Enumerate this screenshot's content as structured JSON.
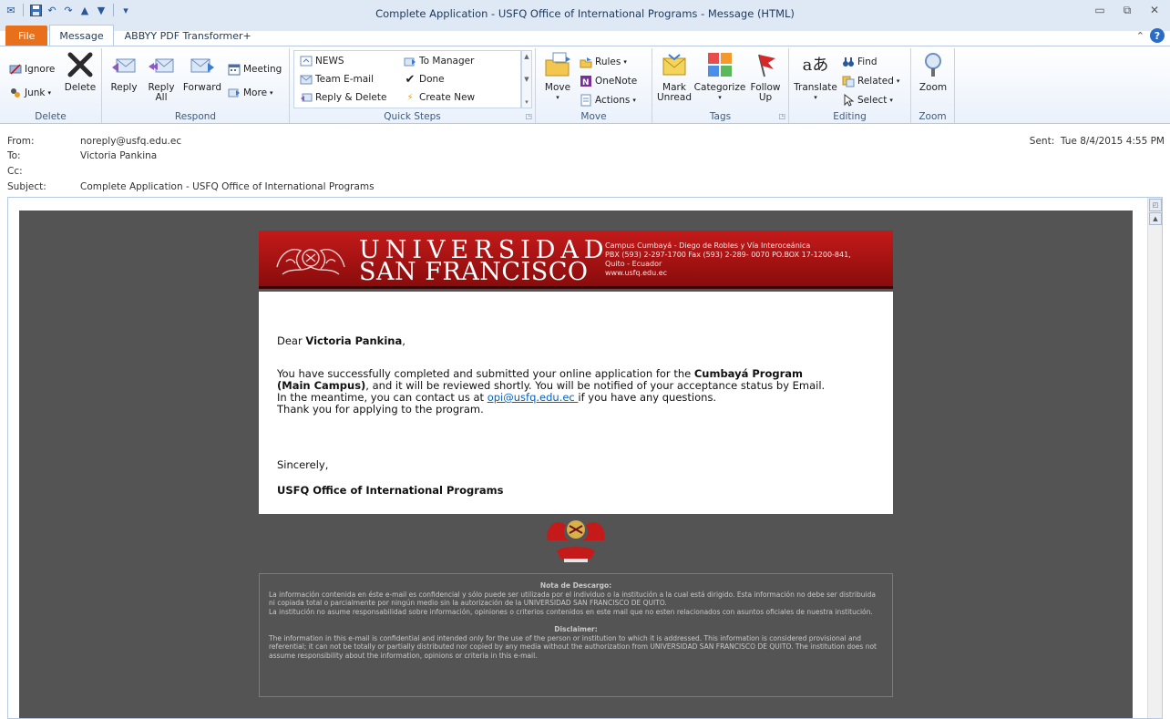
{
  "window": {
    "title": "Complete Application - USFQ Office of International Programs  -  Message (HTML)"
  },
  "tabs": [
    {
      "label": "File"
    },
    {
      "label": "Message"
    },
    {
      "label": "ABBYY PDF Transformer+"
    }
  ],
  "ribbon": {
    "delete_group": {
      "label": "Delete",
      "ignore": "Ignore",
      "junk": "Junk",
      "delete": "Delete"
    },
    "respond_group": {
      "label": "Respond",
      "reply": "Reply",
      "reply_all_1": "Reply",
      "reply_all_2": "All",
      "forward": "Forward",
      "meeting": "Meeting",
      "more": "More"
    },
    "quicksteps_group": {
      "label": "Quick Steps",
      "items": [
        "NEWS",
        "Team E-mail",
        "Reply & Delete",
        "To Manager",
        "Done",
        "Create New"
      ]
    },
    "move_group": {
      "label": "Move",
      "move": "Move",
      "rules": "Rules",
      "onenote": "OneNote",
      "actions": "Actions"
    },
    "tags_group": {
      "label": "Tags",
      "mark_unread_1": "Mark",
      "mark_unread_2": "Unread",
      "categorize": "Categorize",
      "follow_up_1": "Follow",
      "follow_up_2": "Up"
    },
    "editing_group": {
      "label": "Editing",
      "translate": "Translate",
      "find": "Find",
      "related": "Related",
      "select": "Select"
    },
    "zoom_group": {
      "label": "Zoom",
      "zoom": "Zoom"
    }
  },
  "header": {
    "from_label": "From:",
    "from_value": "noreply@usfq.edu.ec",
    "to_label": "To:",
    "to_value": "Victoria Pankina",
    "cc_label": "Cc:",
    "subject_label": "Subject:",
    "subject_value": "Complete Application - USFQ Office of International Programs",
    "sent_label": "Sent:",
    "sent_value": "Tue 8/4/2015 4:55 PM"
  },
  "banner": {
    "line1": "UNIVERSIDAD",
    "line2": "SAN FRANCISCO",
    "info1": "Campus Cumbayá - Diego de Robles y Vía Interoceánica",
    "info2": "PBX (593) 2-297-1700     Fax (593) 2-289- 0070     PO.BOX 17-1200-841,",
    "info3": "Quito - Ecuador",
    "info4": "www.usfq.edu.ec"
  },
  "message": {
    "greeting_prefix": "Dear ",
    "recipient": "Victoria Pankina",
    "greeting_suffix": ",",
    "body_1": "You have successfully completed and submitted your online application for the ",
    "program_1": "Cumbayá Program",
    "program_2": "(Main Campus)",
    "body_2": ", and it will be reviewed shortly. You will be notified of your acceptance status by Email.",
    "body_3": "In the meantime, you can contact us at ",
    "email_link": "opi@usfq.edu.ec ",
    "body_4": "if you have any questions.",
    "body_5": "Thank you for applying to the program.",
    "closing": "Sincerely,",
    "signature": "USFQ Office of International Programs"
  },
  "disclaimer": {
    "es_heading": "Nota de Descargo:",
    "es_text_1": "La información contenida en éste e-mail es confidencial y sólo puede ser utilizada por el individuo o la institución a la cual está dirigido. Esta información no debe ser distribuida ni copiada total o parcialmente por ningún medio sin la autorización de la UNIVERSIDAD SAN FRANCISCO DE QUITO.",
    "es_text_2": "La institución no asume responsabilidad sobre información, opiniones o criterios contenidos en este mail que no esten relacionados con asuntos oficiales de nuestra institución.",
    "en_heading": "Disclaimer:",
    "en_text": "The information in this e-mail is confidential and intended only for the use of the person or institution to which it is addressed. This information is considered provisional and referential; it can not be totally or partially distributed nor copied by any media without the authorization from UNIVERSIDAD SAN FRANCISCO DE QUITO. The institution does not assume responsibility about the information, opinions or criteria in this e-mail."
  },
  "colors": {
    "file_tab": "#e8701a",
    "banner_red": "#c41a1a",
    "email_background": "#545454",
    "link": "#0563c1"
  }
}
